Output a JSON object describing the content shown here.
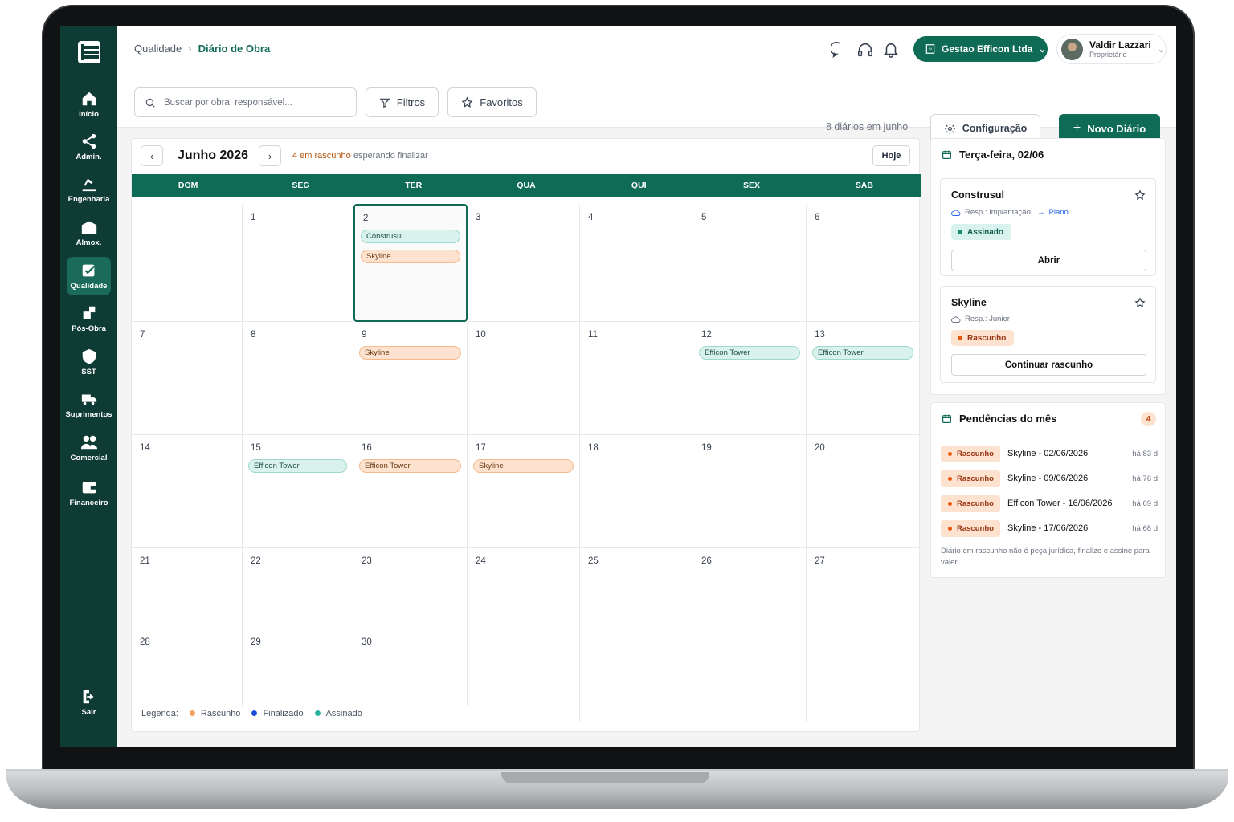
{
  "breadcrumb": {
    "parent": "Qualidade",
    "current": "Diário de Obra"
  },
  "company": "Gestao Efficon Ltda",
  "user": {
    "name": "Valdir Lazzari",
    "role": "Proprietário"
  },
  "sidebar": {
    "items": [
      {
        "label": "Início"
      },
      {
        "label": "Admin."
      },
      {
        "label": "Engenharia"
      },
      {
        "label": "Almox."
      },
      {
        "label": "Qualidade"
      },
      {
        "label": "Pós-Obra"
      },
      {
        "label": "SST"
      },
      {
        "label": "Suprimentos"
      },
      {
        "label": "Comercial"
      },
      {
        "label": "Financeiro"
      }
    ],
    "logout": "Sair"
  },
  "toolbar": {
    "search_placeholder": "Buscar por obra, responsável...",
    "filters": "Filtros",
    "favorites": "Favoritos",
    "count": "8 diários em junho",
    "config": "Configuração",
    "new": "Novo Diário"
  },
  "calendar": {
    "month": "Junho 2026",
    "draft_count": "4 em rascunho",
    "draft_suffix": "esperando finalizar",
    "today": "Hoje",
    "weekdays": [
      "DOM",
      "SEG",
      "TER",
      "QUA",
      "QUI",
      "SEX",
      "SÁB"
    ],
    "days": [
      "",
      "1",
      "2",
      "3",
      "4",
      "5",
      "6",
      "7",
      "8",
      "9",
      "10",
      "11",
      "12",
      "13",
      "14",
      "15",
      "16",
      "17",
      "18",
      "19",
      "20",
      "21",
      "22",
      "23",
      "24",
      "25",
      "26",
      "27",
      "28",
      "29",
      "30"
    ],
    "events": {
      "d2a": "Construsul",
      "d2b": "Skyline",
      "d9": "Skyline",
      "d12": "Efficon Tower",
      "d13": "Efficon Tower",
      "d15": "Efficon Tower",
      "d16": "Efficon Tower",
      "d17": "Skyline"
    },
    "legend": {
      "title": "Legenda:",
      "draft": "Rascunho",
      "final": "Finalizado",
      "signed": "Assinado"
    },
    "colors": {
      "draft": "#f4a261",
      "final": "#1d4ed8",
      "signed": "#2bb3a0",
      "brand": "#0f6b56"
    }
  },
  "day_panel": {
    "title": "Terça-feira, 02/06",
    "cards": [
      {
        "name": "Construsul",
        "resp": "Resp.: Implantação",
        "plan": "Plano",
        "status": "Assinado",
        "action": "Abrir"
      },
      {
        "name": "Skyline",
        "resp": "Resp.: Junior",
        "status": "Rascunho",
        "action": "Continuar rascunho"
      }
    ]
  },
  "pending": {
    "title": "Pendências do mês",
    "count": "4",
    "items": [
      {
        "tag": "Rascunho",
        "text": "Skyline - 02/06/2026",
        "ago": "há 83 d"
      },
      {
        "tag": "Rascunho",
        "text": "Skyline - 09/06/2026",
        "ago": "há 76 d"
      },
      {
        "tag": "Rascunho",
        "text": "Efficon Tower - 16/06/2026",
        "ago": "há 69 d"
      },
      {
        "tag": "Rascunho",
        "text": "Skyline - 17/06/2026",
        "ago": "há 68 d"
      }
    ],
    "note": "Diário em rascunho não é peça jurídica, finalize e assine para valer."
  }
}
